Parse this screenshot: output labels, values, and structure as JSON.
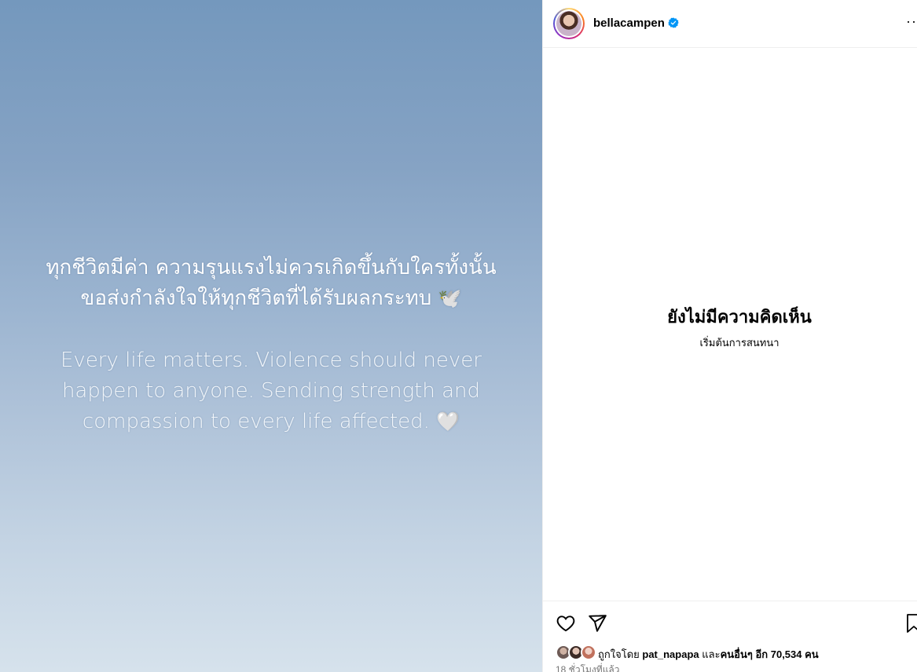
{
  "post": {
    "caption_th_line1": "ทุกชีวิตมีค่า ความรุนแรงไม่ควรเกิดขึ้นกับใครทั้งนั้น",
    "caption_th_line2": "ขอส่งกำลังใจให้ทุกชีวิตที่ได้รับผลกระทบ",
    "dove_emoji": "🕊️",
    "caption_en_line1": "Every life matters. Violence should never",
    "caption_en_line2": "happen to anyone. Sending strength and",
    "caption_en_line3": "compassion to every life affected.",
    "heart_emoji": "🤍",
    "gradient_top": "#7498bd",
    "gradient_bottom": "#d6e2ec"
  },
  "header": {
    "username": "bellacampen",
    "verified_icon": "verified-badge-icon",
    "more_label": "···"
  },
  "comments": {
    "empty_title": "ยังไม่มีความคิดเห็น",
    "empty_subtitle": "เริ่มต้นการสนทนา"
  },
  "actions": {
    "like_icon": "heart-outline-icon",
    "share_icon": "paper-plane-icon",
    "save_icon": "bookmark-icon"
  },
  "likes": {
    "prefix": "ถูกใจโดย",
    "user": "pat_napapa",
    "middle": "และ",
    "others": "คนอื่นๆ อีก 70,534 คน"
  },
  "timestamp": "18 ชั่วโมงที่แล้ว",
  "colors": {
    "verified": "#0095f6",
    "secondary_text": "#737373",
    "border": "#efefef"
  }
}
